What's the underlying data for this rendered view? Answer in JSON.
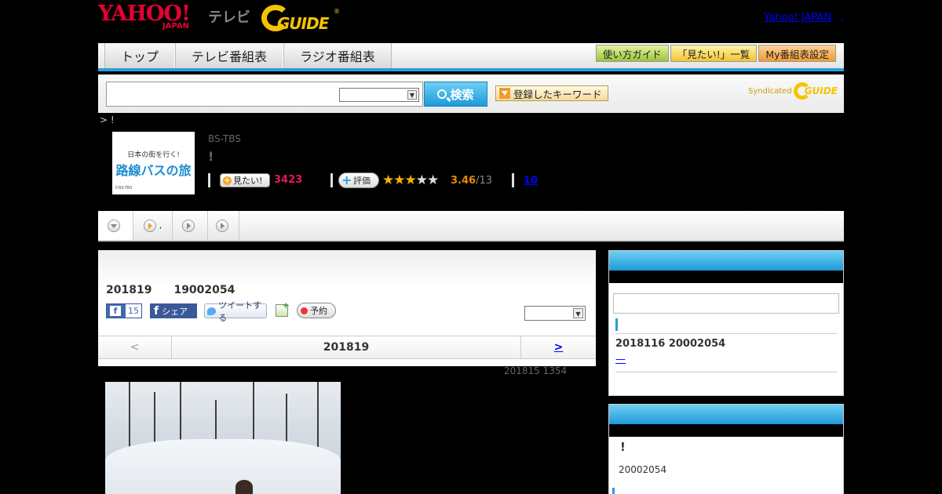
{
  "header": {
    "yahoo_logo": "YAHOO!",
    "yahoo_sub": "JAPAN",
    "tv_label": "テレビ",
    "gguide_logo": "GUIDE",
    "gguide_reg": "®",
    "dot": ",",
    "yahoo_japan_link": "Yahoo! JAPAN",
    "trailing_dot": ","
  },
  "nav": {
    "tabs": [
      {
        "label": "トップ"
      },
      {
        "label": "テレビ番組表"
      },
      {
        "label": "ラジオ番組表"
      }
    ],
    "buttons": [
      {
        "label": "使い方ガイド"
      },
      {
        "label": "「見たい!」一覧"
      },
      {
        "label": "My番組表設定"
      }
    ]
  },
  "search": {
    "placeholder": "",
    "select_value": "",
    "button_label": "検索",
    "keyword_label": "登録したキーワード",
    "syndicated_label": "Syndicated",
    "syndicated_logo": "GUIDE"
  },
  "breadcrumb": "> !",
  "program": {
    "thumb_line1": "日本の街を行く!",
    "thumb_line2": "路線バスの旅",
    "thumb_line3": "©BS-TBS",
    "channel": "BS-TBS",
    "title": "!",
    "want_label": "見たい!",
    "want_count": "3423",
    "rate_label": "評価",
    "stars_filled": 3,
    "stars_total": 5,
    "rating": "3.46",
    "rating_of": "/13",
    "reviews": "10"
  },
  "tabs": [
    {
      "label": ""
    },
    {
      "label": ","
    },
    {
      "label": ""
    },
    {
      "label": ""
    }
  ],
  "main": {
    "air_date": "201819　　19002054",
    "fb_like_count": "15",
    "fb_share_label": "シェア",
    "tweet_label": "ツイートする",
    "reserve_label": "予約",
    "select_value": "",
    "pager_prev": "<",
    "pager_date": "201819",
    "pager_next": ">",
    "updated": "201815  1354"
  },
  "sidebar1": {
    "input_value": "",
    "date": "2018116  20002054",
    "link": "—"
  },
  "sidebar2": {
    "title": "!",
    "time": "20002054"
  },
  "colors": {
    "accent_blue": "#29a0dc",
    "yahoo_red": "#e60033",
    "gguide_yellow": "#f4c400",
    "want_pink": "#e4185b",
    "rating_orange": "#e58a00"
  }
}
